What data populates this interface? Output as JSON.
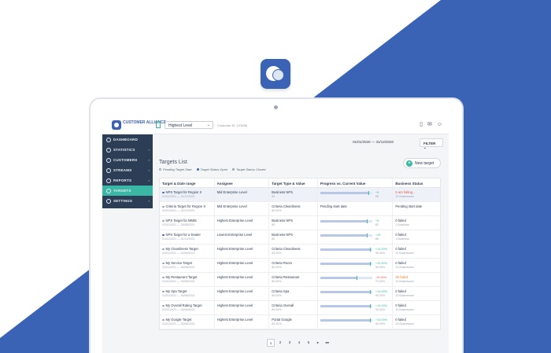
{
  "app": {
    "logo_text": "CUSTOMER ALLIANCE",
    "level_select": "Highest Level",
    "customer_id": "Customer ID: 123456"
  },
  "colors": {
    "brand": "#3b63b5",
    "accent": "#3ab7a5",
    "sidebar": "#2c3e55",
    "danger": "#e05b4a"
  },
  "sidebar": {
    "items": [
      {
        "label": "DASHBOARD",
        "icon": "dashboard-icon",
        "chevron": ""
      },
      {
        "label": "STATISTICS",
        "icon": "statistics-icon",
        "chevron": "›"
      },
      {
        "label": "CUSTOMERS",
        "icon": "customers-icon",
        "chevron": "›"
      },
      {
        "label": "STREAMS",
        "icon": "streams-icon",
        "chevron": "›"
      },
      {
        "label": "REPORTS",
        "icon": "reports-icon",
        "chevron": "›"
      },
      {
        "label": "TARGETS",
        "icon": "targets-icon",
        "chevron": ""
      },
      {
        "label": "SETTINGS",
        "icon": "settings-icon",
        "chevron": "›"
      }
    ]
  },
  "toolbar": {
    "date_range": "01/01/2020 — 31/12/2020",
    "filter_label": "FILTER ⌄",
    "new_target_label": "New target"
  },
  "targets": {
    "title": "Targets List",
    "legend": [
      "Pending Target Start",
      "Target Status Open",
      "Target Status Closed"
    ],
    "columns": [
      "Target & Date range",
      "Assignee",
      "Target Type & Value",
      "Progress vs. Current Value",
      "Business Status"
    ],
    "rows": [
      {
        "name": "NPS Target for Region X",
        "dates": "01/01/2021 — 31/12/2021",
        "assignee": "Mid Enterprise Level",
        "type": "Business NPS",
        "type_sub": "80",
        "progress": 0.92,
        "pv": "+5",
        "pv_sub": "85",
        "status": "5 are failing...",
        "status_sub": "10 Businesses",
        "status_color": "red",
        "pending": false,
        "dot": "#3b63b5"
      },
      {
        "name": "Criteria Target for Region X",
        "dates": "01/01/2021 — 31/12/2021",
        "assignee": "Mid Enterprise Level",
        "type": "Criteria Cleanliness",
        "type_sub": "85.00%",
        "progress": 0,
        "pv": "",
        "pv_sub": "",
        "pending_text": "Pending start date",
        "status": "Pending start date",
        "status_sub": "",
        "status_color": "",
        "pending": true,
        "dot": "#9aa2b1"
      },
      {
        "name": "NPS Target for MMIE",
        "dates": "01/01/2021 — 30/06/2021",
        "assignee": "Highest Enterprise Level",
        "type": "Business NPS",
        "type_sub": "80",
        "progress": 0.9,
        "pv": "+5",
        "pv_sub": "82",
        "status": "0 failed",
        "status_sub": "1 Business",
        "status_color": "",
        "pending": false,
        "dot": "#9aa2b1"
      },
      {
        "name": "NPS Target for a Dealer",
        "dates": "01/01/2021 — 31/12/2021",
        "assignee": "Lowest Enterprise Level",
        "type": "Business NPS",
        "type_sub": "80",
        "progress": 0.9,
        "pv": "+15",
        "pv_sub": "85",
        "status": "0 failed",
        "status_sub": "1 Business",
        "status_color": "",
        "pending": false,
        "dot": "#3b63b5"
      },
      {
        "name": "My Cleanliness Target",
        "dates": "01/01/2021 — 30/06/2021",
        "assignee": "Highest Enterprise Level",
        "type": "Criteria Cleanliness",
        "type_sub": "80.00%",
        "progress": 0.95,
        "pv": "+10.00%",
        "pv_sub": "90.00%",
        "status": "0 failed",
        "status_sub": "10 Businesses",
        "status_color": "",
        "pending": false,
        "dot": "#9aa2b1"
      },
      {
        "name": "My Service Target",
        "dates": "01/01/2021 — 30/06/2021",
        "assignee": "Highest Enterprise Level",
        "type": "Criteria Room",
        "type_sub": "80.00%",
        "progress": 0.95,
        "pv": "+10.00%",
        "pv_sub": "90.00%",
        "status": "0 failed",
        "status_sub": "10 Businesses",
        "status_color": "",
        "pending": false,
        "dot": "#9aa2b1"
      },
      {
        "name": "My Restaurant Target",
        "dates": "01/01/2021 — 30/06/2021",
        "assignee": "Highest Enterprise Level",
        "type": "Criteria Restaurant",
        "type_sub": "80.00%",
        "progress": 0.7,
        "pv": "-10.00%",
        "pv_sub": "70.00%",
        "status": "20 failed",
        "status_sub": "10 Businesses",
        "status_color": "orange",
        "pending": false,
        "neg": true,
        "dot": "#9aa2b1"
      },
      {
        "name": "My Spa Target",
        "dates": "01/01/2021 — 30/06/2021",
        "assignee": "Highest Enterprise Level",
        "type": "Criteria Spa",
        "type_sub": "80.00%",
        "progress": 0.95,
        "pv": "+10.00%",
        "pv_sub": "90.00%",
        "status": "0 failed",
        "status_sub": "10 Businesses",
        "status_color": "",
        "pending": false,
        "dot": "#9aa2b1"
      },
      {
        "name": "My Overall Rating Target",
        "dates": "01/01/2021 — 30/06/2021",
        "assignee": "Highest Enterprise Level",
        "type": "Criteria Overall",
        "type_sub": "80.00%",
        "progress": 0.95,
        "pv": "+10.00%",
        "pv_sub": "90.00%",
        "status": "0 failed",
        "status_sub": "10 Businesses",
        "status_color": "",
        "pending": false,
        "dot": "#9aa2b1"
      },
      {
        "name": "My Google Target",
        "dates": "01/01/2021 — 30/06/2021",
        "assignee": "Highest Enterprise Level",
        "type": "Portal Google",
        "type_sub": "80.00%",
        "progress": 0.95,
        "pv": "+10.00%",
        "pv_sub": "90.00%",
        "status": "0 failed",
        "status_sub": "10 Businesses",
        "status_color": "",
        "pending": false,
        "dot": "#9aa2b1"
      }
    ]
  },
  "pagination": {
    "pages": [
      "1",
      "2",
      "3",
      "4",
      "5"
    ],
    "next": "▸",
    "last": "▸▸",
    "current": "1"
  }
}
